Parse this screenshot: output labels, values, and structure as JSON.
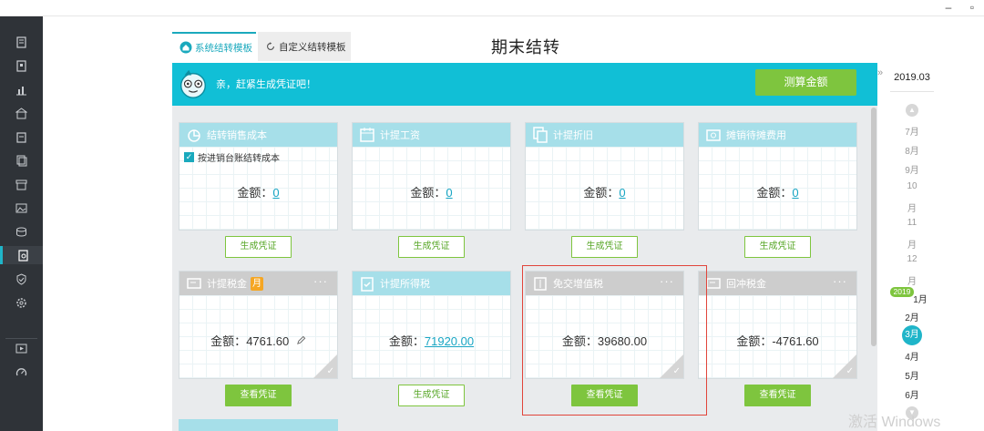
{
  "window": {
    "minimize": "–",
    "close": "▫"
  },
  "tabs": [
    {
      "label": "系统结转模板"
    },
    {
      "label": "自定义结转模板"
    }
  ],
  "page_title": "期末结转",
  "banner": {
    "message": "亲，赶紧生成凭证吧！",
    "calc_button": "测算金额"
  },
  "cards": [
    {
      "title": "结转销售成本",
      "amount_label": "金额：",
      "amount": "0",
      "checkbox_label": "按进销台账结转成本",
      "button": "生成凭证"
    },
    {
      "title": "计提工资",
      "amount_label": "金额：",
      "amount": "0",
      "button": "生成凭证"
    },
    {
      "title": "计提折旧",
      "amount_label": "金额：",
      "amount": "0",
      "button": "生成凭证"
    },
    {
      "title": "摊销待摊费用",
      "amount_label": "金额：",
      "amount": "0",
      "button": "生成凭证"
    },
    {
      "title": "计提税金",
      "badge": "月",
      "amount_label": "金额：",
      "amount": "4761.60",
      "button": "查看凭证"
    },
    {
      "title": "计提所得税",
      "amount_label": "金额：",
      "amount": "71920.00",
      "button": "生成凭证"
    },
    {
      "title": "免交增值税",
      "amount_label": "金额：",
      "amount": "39680.00",
      "button": "查看凭证"
    },
    {
      "title": "回冲税金",
      "amount_label": "金额：",
      "amount": "-4761.60",
      "button": "查看凭证"
    }
  ],
  "card_menu": "···",
  "period": {
    "selected": "2019.03",
    "months_prev_year": [
      "7月",
      "8月",
      "9月",
      "10",
      "月",
      "11",
      "月",
      "12",
      "月"
    ],
    "year_tag": "2019",
    "months": [
      "1月",
      "2月",
      "3月",
      "4月",
      "5月",
      "6月"
    ],
    "selected_month": "3月",
    "toggle": "»"
  },
  "watermark": "激活 Windows",
  "colors": {
    "accent": "#11bfd6",
    "green": "#7ec53e",
    "highlight": "#e1453b",
    "sidebar": "#2f3338"
  }
}
